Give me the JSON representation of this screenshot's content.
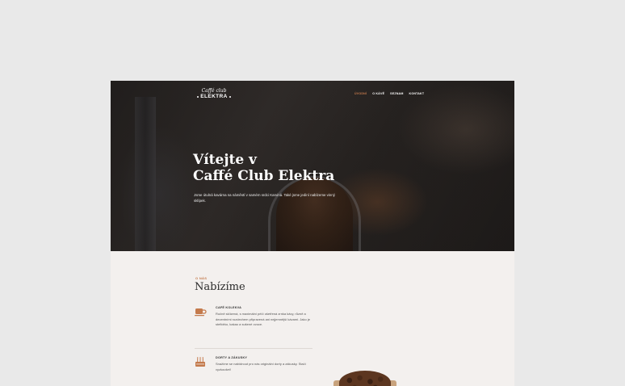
{
  "logo": {
    "script": "Caffé club",
    "name": "ELEKTRA"
  },
  "nav": [
    {
      "label": "ÚVODNÍ",
      "active": true
    },
    {
      "label": "O KÁVĚ",
      "active": false
    },
    {
      "label": "SEZNAM",
      "active": false
    },
    {
      "label": "KONTAKT",
      "active": false
    }
  ],
  "hero": {
    "title_line1": "Vítejte v",
    "title_line2": "Caffé Club Elektra",
    "text": "Jsme útulná kavárna na náměstí v samém srdci Karviná. Také jsme jediní nabízeme vinný sklípek."
  },
  "about": {
    "eyebrow": "O NÁS",
    "title": "Nabízíme",
    "items": [
      {
        "icon": "coffee-cup-icon",
        "title": "CAFÉ KOLEKVA",
        "desc": "Ručně sklízená, s maximální péčí ošetřená zrnka kávy, různě a decentními rozdechem připravená ani nejjemnější kávami. Jako je stefidrko, kakao a sušené ovoce."
      },
      {
        "icon": "cake-icon",
        "title": "DORTY A ZÁKUSKY",
        "desc": "Snažíme se nabídnout pro nás originální dorty a zákusky. Stačí vyzkoušet!"
      }
    ]
  },
  "colors": {
    "accent": "#c47a4c",
    "hero_dark": "#2a2726",
    "content_bg": "#f3f0ee",
    "page_bg": "#e9e9e9"
  }
}
